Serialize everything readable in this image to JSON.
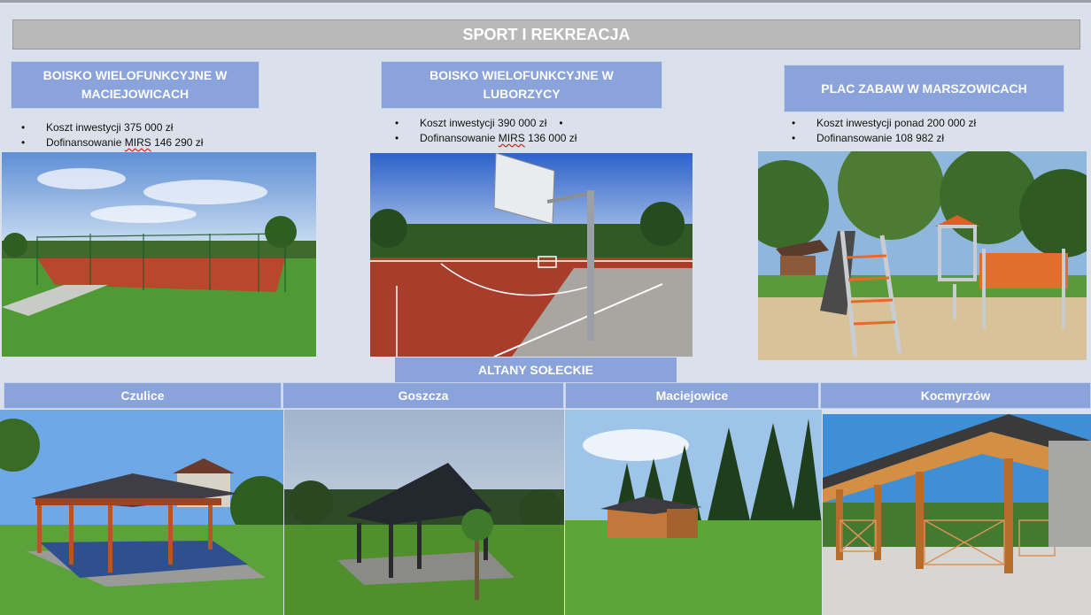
{
  "title": "SPORT I REKREACJA",
  "projects": [
    {
      "line1": "BOISKO WIELOFUNKCYJNE W",
      "line2": "MACIEJOWICACH",
      "cost_prefix": "Koszt inwestycji 375 000 zł",
      "fund_prefix": "Dofinansowanie ",
      "fund_mid": "MIRS",
      "fund_suffix": " 146 290 zł",
      "photo_icon": "multisport-field-photo"
    },
    {
      "line1": "BOISKO WIELOFUNKCYJNE W",
      "line2": "LUBORZYCY",
      "cost_prefix": "Koszt inwestycji 390 000 zł",
      "fund_prefix": "Dofinansowanie ",
      "fund_mid": "MIRS",
      "fund_suffix": " 136 000 zł",
      "photo_icon": "basketball-court-photo"
    },
    {
      "line1": "PLAC ZABAW W MARSZOWICACH",
      "line2": "",
      "cost_prefix": "Koszt inwestycji ponad 200 000 zł",
      "fund_prefix": "Dofinansowanie 108 982 zł",
      "fund_mid": "",
      "fund_suffix": "",
      "photo_icon": "playground-photo"
    }
  ],
  "altany_title": "ALTANY SOŁECKIE",
  "gazebos": [
    {
      "name": "Czulice",
      "photo_icon": "gazebo-photo"
    },
    {
      "name": "Goszcza",
      "photo_icon": "gazebo-photo"
    },
    {
      "name": "Maciejowice",
      "photo_icon": "gazebo-photo"
    },
    {
      "name": "Kocmyrzów",
      "photo_icon": "gazebo-photo"
    }
  ],
  "colors": {
    "background": "#dbe1ea",
    "header_blue": "#8aa3da",
    "title_gray": "#b9b9b9"
  }
}
